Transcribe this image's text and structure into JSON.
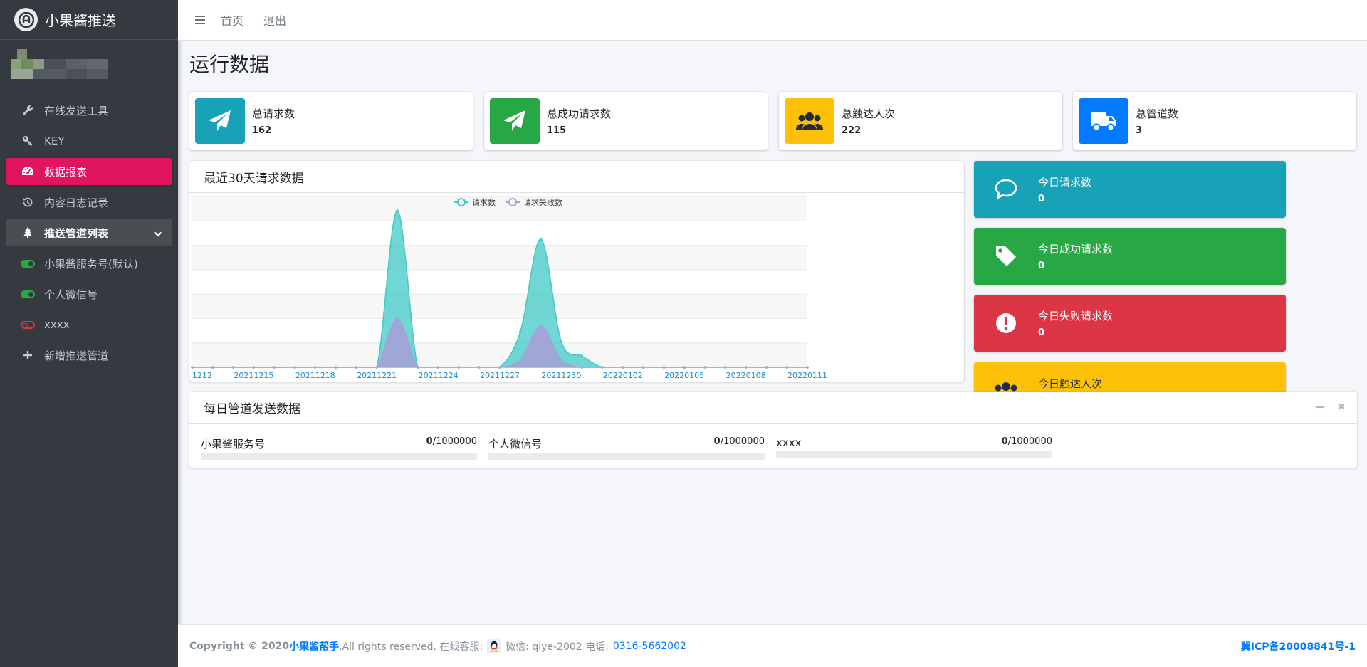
{
  "brand": {
    "name": "小果酱推送"
  },
  "sidebar": {
    "items": [
      {
        "label": "在线发送工具",
        "icon": "wrench-icon"
      },
      {
        "label": "KEY",
        "icon": "key-icon"
      },
      {
        "label": "数据报表",
        "icon": "tachometer-icon"
      },
      {
        "label": "内容日志记录",
        "icon": "history-icon"
      },
      {
        "label": "推送管道列表",
        "icon": "tree-icon"
      },
      {
        "label": "小果酱服务号(默认)",
        "icon": "toggle-on-icon"
      },
      {
        "label": "个人微信号",
        "icon": "toggle-on-icon"
      },
      {
        "label": "xxxx",
        "icon": "toggle-off-icon"
      },
      {
        "label": "新增推送管道",
        "icon": "plus-icon"
      }
    ]
  },
  "topnav": {
    "home": "首页",
    "logout": "退出"
  },
  "page": {
    "title": "运行数据"
  },
  "stats": [
    {
      "label": "总请求数",
      "value": "162",
      "color": "#17a2b8",
      "icon": "paper-plane-icon"
    },
    {
      "label": "总成功请求数",
      "value": "115",
      "color": "#28a745",
      "icon": "paper-plane-icon"
    },
    {
      "label": "总触达人次",
      "value": "222",
      "color": "#ffc107",
      "icon": "users-icon"
    },
    {
      "label": "总管道数",
      "value": "3",
      "color": "#007bff",
      "icon": "truck-icon"
    }
  ],
  "chart_card": {
    "title": "最近30天请求数据"
  },
  "chart_data": {
    "type": "area",
    "x": [
      "20211212",
      "20211213",
      "20211214",
      "20211215",
      "20211216",
      "20211217",
      "20211218",
      "20211219",
      "20211220",
      "20211221",
      "20211222",
      "20211223",
      "20211224",
      "20211225",
      "20211226",
      "20211227",
      "20211228",
      "20211229",
      "20211230",
      "20211231",
      "20220101",
      "20220102",
      "20220103",
      "20220104",
      "20220105",
      "20220106",
      "20220107",
      "20220108",
      "20220109",
      "20220110",
      "20220111"
    ],
    "x_tick_labels": [
      "1212",
      "20211215",
      "20211218",
      "20211221",
      "20211224",
      "20211227",
      "20211230",
      "20220102",
      "20220105",
      "20220108",
      "20220111"
    ],
    "series": [
      {
        "name": "请求数",
        "color": "#40c9c6",
        "values": [
          0,
          0,
          0,
          0,
          0,
          0,
          0,
          0,
          0,
          0,
          110,
          0,
          0,
          0,
          0,
          0,
          25,
          90,
          18,
          8,
          0,
          0,
          0,
          0,
          0,
          0,
          0,
          0,
          0,
          0,
          0
        ]
      },
      {
        "name": "请求失败数",
        "color": "#a89fd8",
        "values": [
          0,
          0,
          0,
          0,
          0,
          0,
          0,
          0,
          0,
          0,
          34,
          0,
          0,
          0,
          0,
          0,
          5,
          29,
          5,
          0,
          0,
          0,
          0,
          0,
          0,
          0,
          0,
          0,
          0,
          0,
          0
        ]
      }
    ],
    "ylim": [
      0,
      120
    ],
    "legend": "top-center",
    "grid": true
  },
  "today": [
    {
      "label": "今日请求数",
      "value": "0",
      "color": "#17a2b8",
      "icon": "comment-icon"
    },
    {
      "label": "今日成功请求数",
      "value": "0",
      "color": "#28a745",
      "icon": "tag-icon"
    },
    {
      "label": "今日失败请求数",
      "value": "0",
      "color": "#dc3545",
      "icon": "exclamation-circle-icon"
    },
    {
      "label": "今日触达人次",
      "value": "0",
      "color": "#ffc107",
      "icon": "users-icon"
    }
  ],
  "pipeline_card": {
    "title": "每日管道发送数据",
    "items": [
      {
        "name": "小果酱服务号",
        "used": "0",
        "limit": "/1000000"
      },
      {
        "name": "个人微信号",
        "used": "0",
        "limit": "/1000000"
      },
      {
        "name": "xxxx",
        "used": "0",
        "limit": "/1000000"
      }
    ]
  },
  "footer": {
    "copyright": "Copyright © 2020 ",
    "brand": "小果酱帮手",
    "rights": ".All rights reserved. 在线客服:",
    "wechat": " 微信:  qiye-2002 电话:",
    "phone": "0316-5662002",
    "icp": "冀ICP备20008841号-1"
  }
}
